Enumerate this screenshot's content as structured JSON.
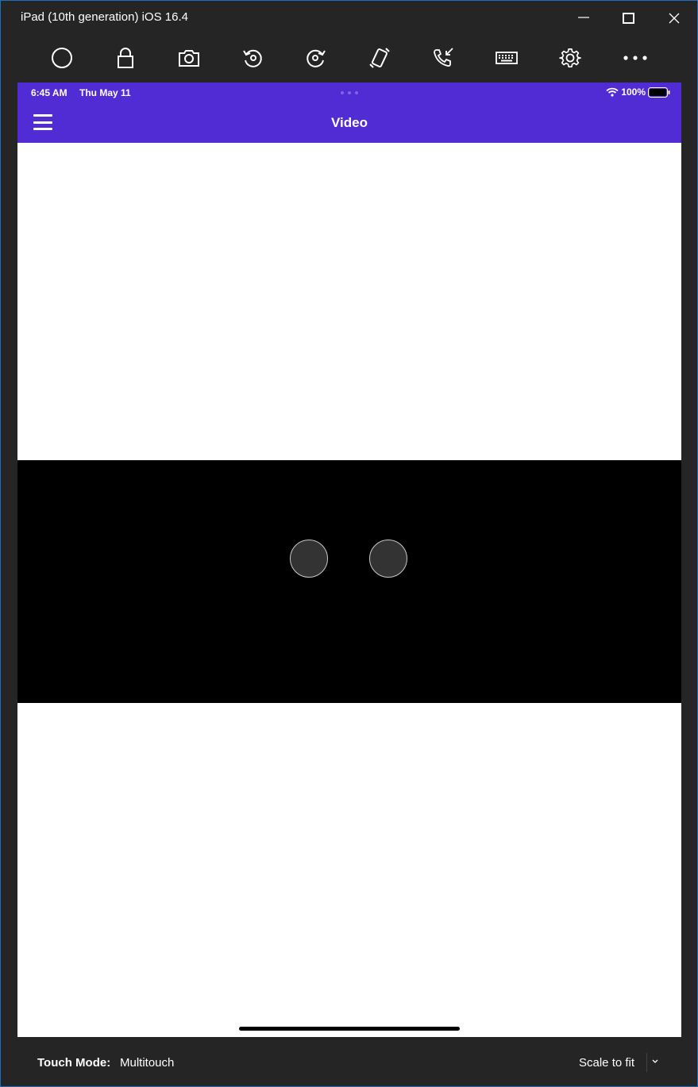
{
  "window": {
    "title": "iPad (10th generation) iOS 16.4",
    "controls": [
      "minimize-icon",
      "maximize-icon",
      "close-icon"
    ]
  },
  "toolbar": {
    "tools": [
      {
        "name": "home-button",
        "icon": "circle-icon"
      },
      {
        "name": "lock-button",
        "icon": "lock-icon"
      },
      {
        "name": "screenshot-button",
        "icon": "camera-icon"
      },
      {
        "name": "rotate-left-button",
        "icon": "rotate-left-icon"
      },
      {
        "name": "rotate-right-button",
        "icon": "rotate-right-icon"
      },
      {
        "name": "shake-button",
        "icon": "shake-icon"
      },
      {
        "name": "call-button",
        "icon": "phone-incoming-icon"
      },
      {
        "name": "keyboard-button",
        "icon": "keyboard-icon"
      },
      {
        "name": "settings-button",
        "icon": "gear-icon"
      },
      {
        "name": "more-button",
        "icon": "more-icon"
      }
    ]
  },
  "device": {
    "status": {
      "time": "6:45 AM",
      "date": "Thu May 11",
      "battery": "100%"
    },
    "nav": {
      "title": "Video"
    },
    "colors": {
      "accent": "#512bd4",
      "video_bg": "#000000"
    }
  },
  "bottom": {
    "touch_mode_label": "Touch Mode:",
    "touch_mode_value": "Multitouch",
    "scale": "Scale to fit"
  }
}
